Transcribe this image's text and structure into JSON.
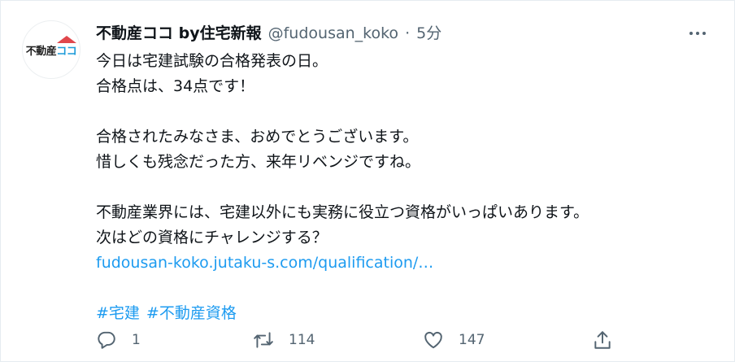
{
  "account": {
    "name": "不動産ココ by住宅新報",
    "handle": "@fudousan_koko",
    "separator": "·",
    "time": "5分",
    "logo_part_a": "不動産",
    "logo_part_b": "ココ"
  },
  "tweet": {
    "line1": "今日は宅建試験の合格発表の日。",
    "line2": "合格点は、34点です！",
    "line3": "合格されたみなさま、おめでとうございます。",
    "line4": "惜しくも残念だった方、来年リベンジですね。",
    "line5": "不動産業界には、宅建以外にも実務に役立つ資格がいっぱいあります。",
    "line6": "次はどの資格にチャレンジする？",
    "link": "fudousan-koko.jutaku-s.com/qualification/…",
    "hashtags": [
      "#宅建",
      "#不動産資格"
    ]
  },
  "actions": {
    "replies": "1",
    "retweets": "114",
    "likes": "147"
  },
  "icons": {
    "more": "more-icon",
    "reply": "reply-icon",
    "retweet": "retweet-icon",
    "like": "heart-icon",
    "share": "share-icon"
  },
  "colors": {
    "link": "#1d9bf0",
    "text": "#0f1419",
    "muted": "#536471",
    "logo_accent": "#1d9bd9"
  }
}
